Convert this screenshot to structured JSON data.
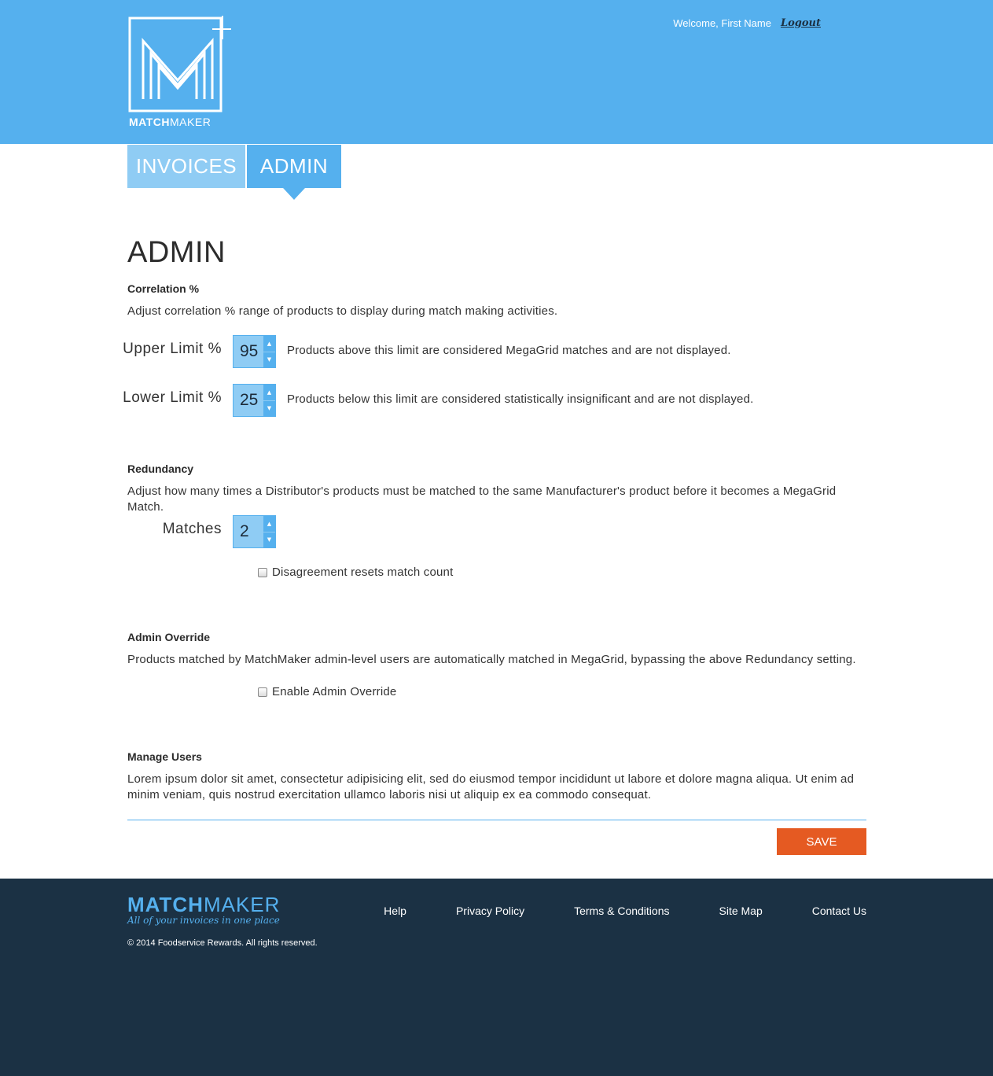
{
  "header": {
    "logo_word_bold": "MATCH",
    "logo_word_light": "MAKER",
    "welcome": "Welcome, First Name",
    "logout": "Logout"
  },
  "tabs": [
    {
      "label": "INVOICES"
    },
    {
      "label": "ADMIN"
    }
  ],
  "page_title": "ADMIN",
  "correlation": {
    "heading": "Correlation %",
    "description": "Adjust correlation % range of products to display during match making activities.",
    "upper": {
      "label": "Upper Limit %",
      "value": "95",
      "help": "Products above this limit are considered MegaGrid matches and are not displayed."
    },
    "lower": {
      "label": "Lower Limit %",
      "value": "25",
      "help": "Products below this limit are considered statistically insignificant and are not displayed."
    }
  },
  "redundancy": {
    "heading": "Redundancy",
    "description": "Adjust how many times a Distributor's products must be matched to the same Manufacturer's product before it becomes a MegaGrid Match.",
    "matches_label": "Matches",
    "matches_value": "2",
    "checkbox_label": "Disagreement resets match count"
  },
  "override": {
    "heading": "Admin Override",
    "description": "Products matched by MatchMaker admin-level users are automatically matched in MegaGrid, bypassing the above Redundancy setting.",
    "checkbox_label": "Enable Admin Override"
  },
  "users": {
    "heading": "Manage Users",
    "description": "Lorem ipsum dolor sit amet, consectetur adipisicing elit, sed do eiusmod tempor incididunt ut labore et dolore magna aliqua. Ut enim ad minim veniam, quis nostrud exercitation ullamco laboris nisi ut aliquip ex ea commodo consequat."
  },
  "save_label": "SAVE",
  "footer": {
    "logo_bold": "MATCH",
    "logo_light": "MAKER",
    "tagline": "All of your invoices in one place",
    "copyright": "© 2014 Foodservice Rewards. All rights reserved.",
    "links": [
      "Help",
      "Privacy Policy",
      "Terms & Conditions",
      "Site Map",
      "Contact Us"
    ]
  },
  "colors": {
    "brand_blue": "#55b0ee",
    "light_blue": "#8fccf4",
    "save_orange": "#e55a22",
    "footer_navy": "#1b3144"
  },
  "icons": [
    "matchmaker-logo-icon",
    "spinner-up-icon",
    "spinner-down-icon",
    "checkbox-icon"
  ]
}
